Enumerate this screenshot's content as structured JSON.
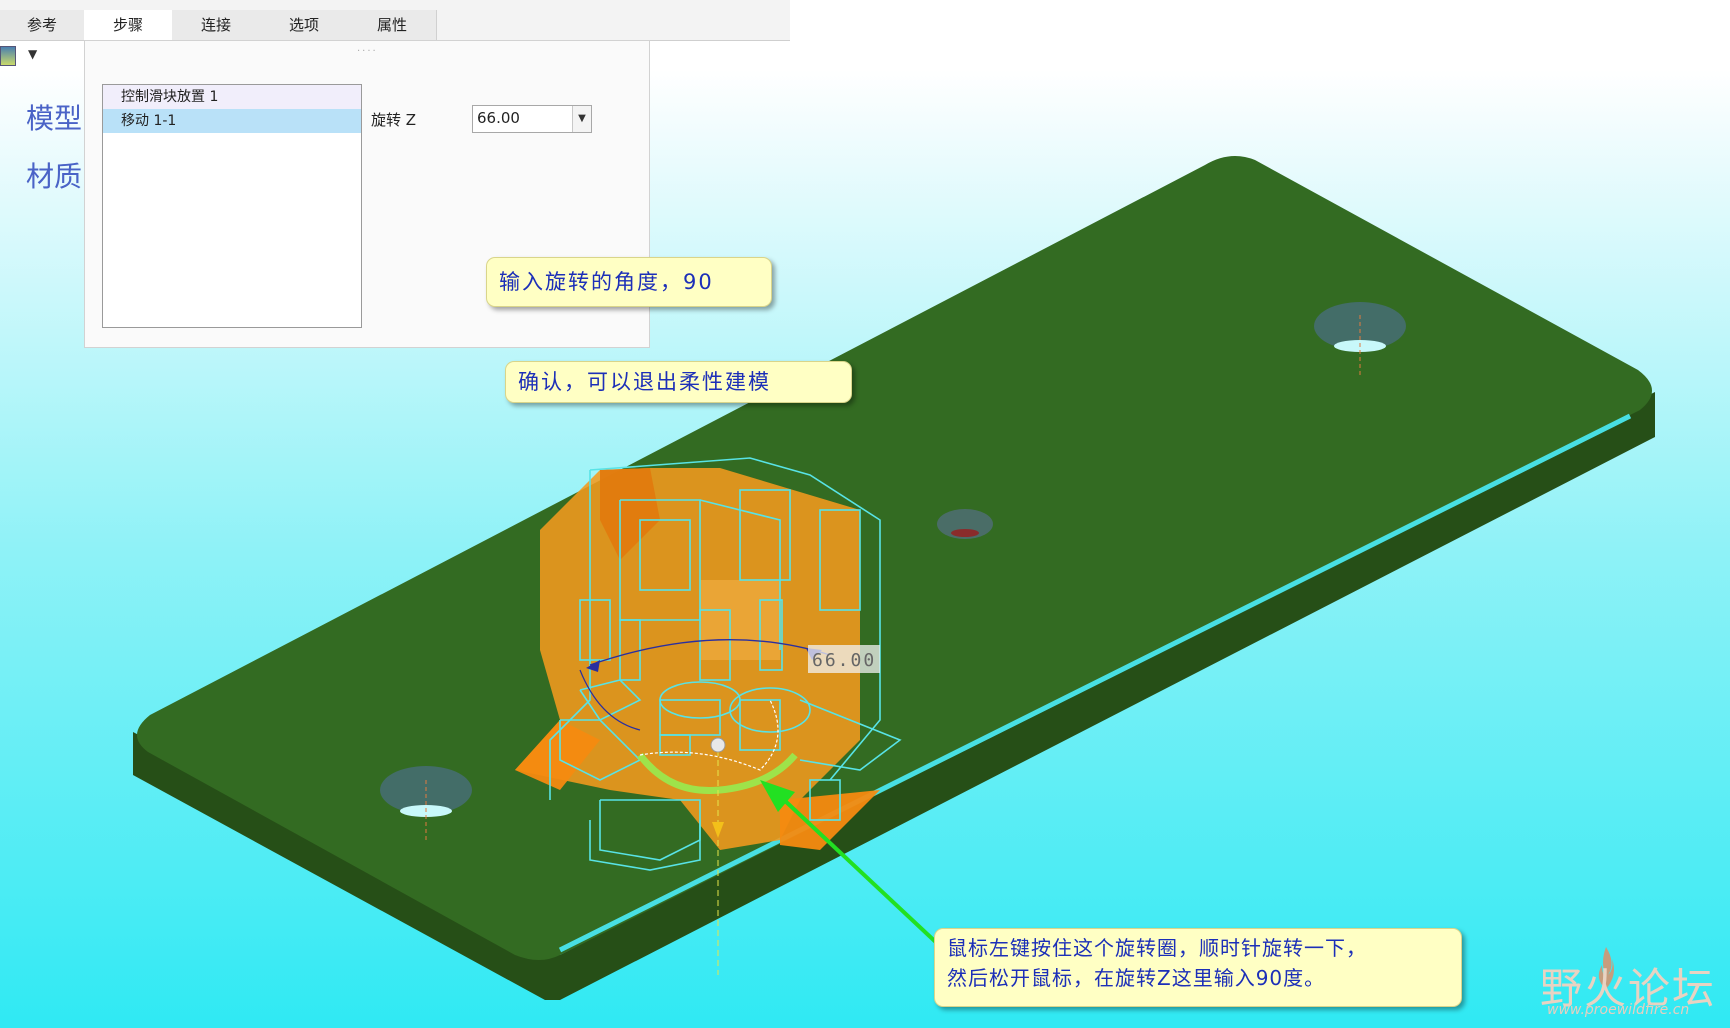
{
  "tabs": [
    {
      "label": "参考",
      "active": false
    },
    {
      "label": "步骤",
      "active": true
    },
    {
      "label": "连接",
      "active": false
    },
    {
      "label": "选项",
      "active": false
    },
    {
      "label": "属性",
      "active": false
    }
  ],
  "toolbar": {
    "dropdown_icon": "caret-down-icon"
  },
  "model_tree": {
    "line1": "模型",
    "line2": "材质"
  },
  "step_panel": {
    "steps": [
      "控制滑块放置 1",
      "移动 1-1"
    ],
    "selected_step": "移动 1-1",
    "rotation_label": "旋转 Z",
    "rotation_value": "66.00"
  },
  "viewport": {
    "dimension_label": "66.00",
    "plate_color": "#336b22",
    "part_color": "#f39a1e",
    "wire_color": "#4fdde0"
  },
  "callouts": {
    "enter_angle": "输入旋转的角度，90",
    "confirm": "确认，可以退出柔性建模",
    "instruction_line1": "鼠标左键按住这个旋转圈，顺时针旋转一下，",
    "instruction_line2": "然后松开鼠标，在旋转Z这里输入90度。"
  },
  "watermark": {
    "brand": "野火论坛",
    "url": "www.proewildfire.cn"
  }
}
